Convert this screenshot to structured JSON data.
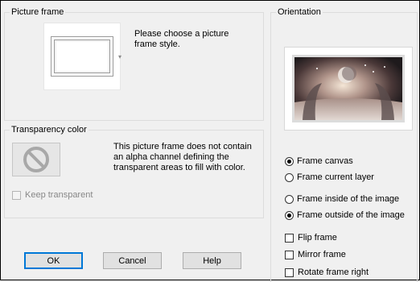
{
  "picture_frame": {
    "title": "Picture frame",
    "description": "Please choose a picture frame style."
  },
  "transparency": {
    "title": "Transparency color",
    "description": "This picture frame does not contain an alpha channel defining the transparent areas to fill with color.",
    "keep_transparent_label": "Keep transparent",
    "keep_transparent_checked": false,
    "keep_transparent_enabled": false
  },
  "orientation": {
    "title": "Orientation",
    "apply_to": {
      "options": [
        "Frame canvas",
        "Frame current layer"
      ],
      "selected": "Frame canvas"
    },
    "placement": {
      "options": [
        "Frame inside of the image",
        "Frame outside of the image"
      ],
      "selected": "Frame outside of the image"
    },
    "checkboxes": [
      {
        "label": "Flip frame",
        "checked": false
      },
      {
        "label": "Mirror frame",
        "checked": false
      },
      {
        "label": "Rotate frame right",
        "checked": false
      }
    ]
  },
  "buttons": {
    "ok": "OK",
    "cancel": "Cancel",
    "help": "Help"
  },
  "colors": {
    "dialog_bg": "#f0f0f0",
    "default_button_border": "#0078d7"
  }
}
